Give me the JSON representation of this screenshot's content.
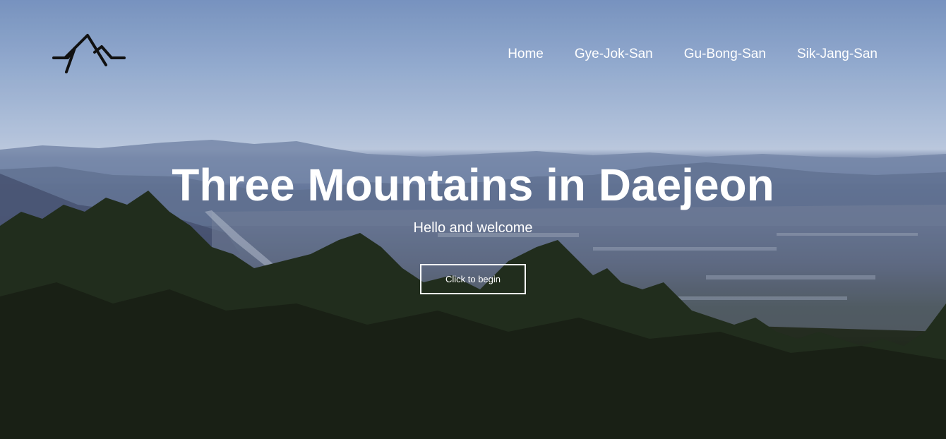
{
  "brand": {
    "logo_icon": "mountain-logo-icon"
  },
  "nav": {
    "items": [
      {
        "label": "Home"
      },
      {
        "label": "Gye-Jok-San"
      },
      {
        "label": "Gu-Bong-San"
      },
      {
        "label": "Sik-Jang-San"
      }
    ]
  },
  "hero": {
    "title": "Three Mountains in Daejeon",
    "subtitle": "Hello and welcome",
    "cta_label": "Click to begin"
  },
  "colors": {
    "text": "#ffffff",
    "logo": "#111111",
    "sky": "#9cb5db",
    "forest": "#1f2619"
  }
}
